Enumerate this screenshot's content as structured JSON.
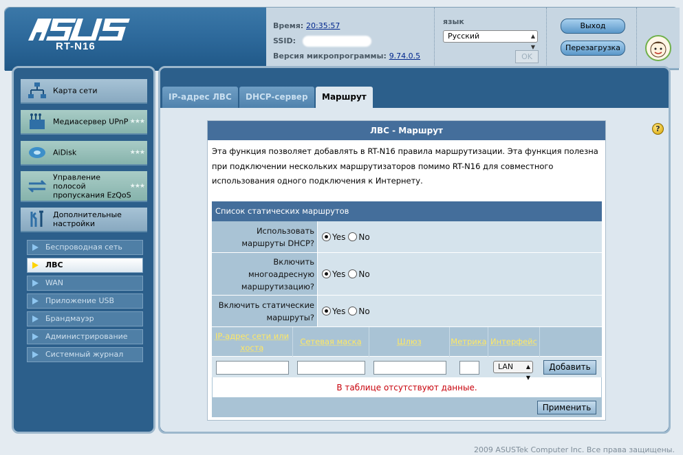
{
  "header": {
    "brand": "/ISUS",
    "model": "RT-N16",
    "time_label": "Время:",
    "time_value": "20:35:57",
    "ssid_label": "SSID:",
    "firmware_label": "Версия микропрограммы:",
    "firmware_value": "9.74.0.5",
    "language_label": "язык",
    "language_value": "Русский",
    "ok_label": "OK",
    "logout_label": "Выход",
    "reboot_label": "Перезагрузка"
  },
  "sidebar": {
    "items": [
      {
        "label": "Карта сети",
        "icon": "network-map-icon"
      },
      {
        "label": "Медиасервер UPnP",
        "icon": "media-server-icon"
      },
      {
        "label": "AiDisk",
        "icon": "aidisk-icon"
      },
      {
        "label": "Управление полосой пропускания EzQoS",
        "icon": "bandwidth-icon"
      },
      {
        "label": "Дополнительные настройки",
        "icon": "tools-icon"
      }
    ],
    "subitems": [
      {
        "label": "Беспроводная сеть"
      },
      {
        "label": "ЛВС"
      },
      {
        "label": "WAN"
      },
      {
        "label": "Приложение USB"
      },
      {
        "label": "Брандмауэр"
      },
      {
        "label": "Администрирование"
      },
      {
        "label": "Системный журнал"
      }
    ]
  },
  "tabs": [
    {
      "label": "IP-адрес ЛВС"
    },
    {
      "label": "DHCP-сервер"
    },
    {
      "label": "Маршрут"
    }
  ],
  "content": {
    "title": "ЛВС - Маршрут",
    "description": "Эта функция позволяет добавлять в RT-N16 правила маршрутизации. Эта функция полезна при подключении нескольких маршрутизаторов помимо RT-N16 для совместного использования одного подключения к Интернету.",
    "table_title": "Список статических маршрутов",
    "options": [
      {
        "label": "Использовать маршруты DHCP?",
        "yes": "Yes",
        "no": "No",
        "selected": "Yes"
      },
      {
        "label": "Включить многоадресную маршрутизацию?",
        "yes": "Yes",
        "no": "No",
        "selected": "Yes"
      },
      {
        "label": "Включить статические маршруты?",
        "yes": "Yes",
        "no": "No",
        "selected": "Yes"
      }
    ],
    "columns": [
      "IP-адрес сети или хоста",
      "Сетевая маска",
      "Шлюз",
      "Метрика",
      "Интерфейс"
    ],
    "interface_value": "LAN",
    "add_label": "Добавить",
    "no_data": "В таблице отсутствуют данные.",
    "apply_label": "Применить"
  },
  "footer": "2009 ASUSTek Computer Inc. Все права защищены."
}
